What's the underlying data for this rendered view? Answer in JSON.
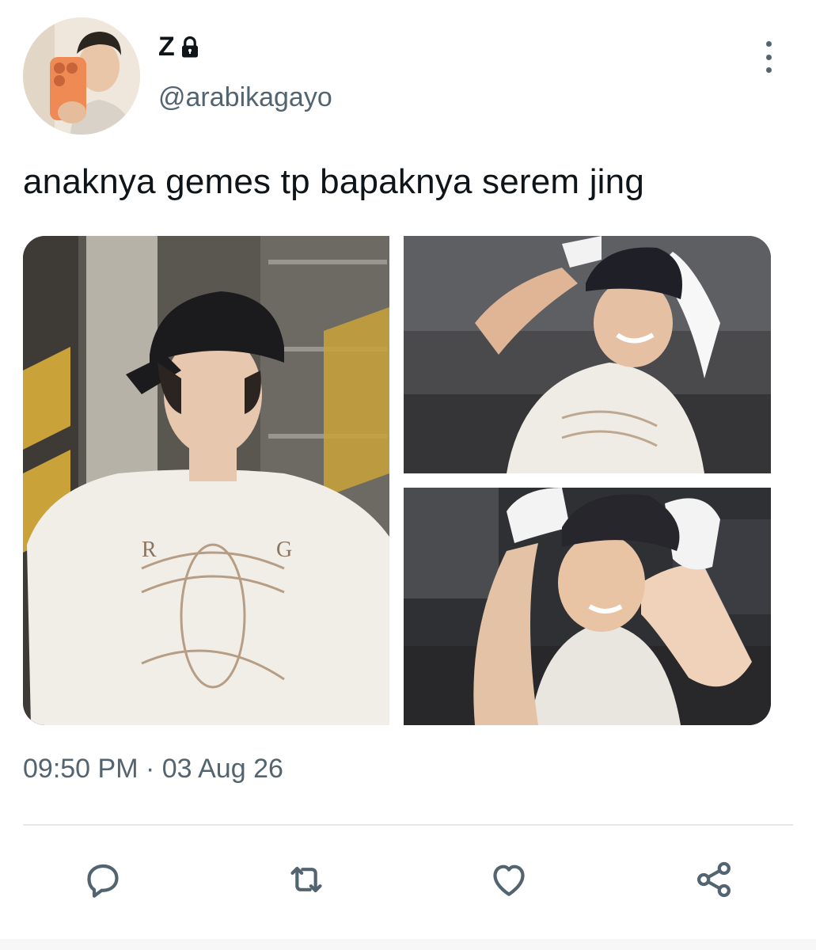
{
  "author": {
    "display_name": "Z",
    "handle": "@arabikagayo",
    "protected_icon": "lock-icon"
  },
  "tweet": {
    "text": "anaknya gemes tp bapaknya serem jing",
    "timestamp": "09:50 PM · 03 Aug 26"
  },
  "media": [
    {
      "name": "photo-1",
      "icon": "image"
    },
    {
      "name": "photo-2",
      "icon": "image"
    },
    {
      "name": "photo-3",
      "icon": "image"
    }
  ],
  "actions": [
    {
      "name": "reply",
      "icon": "reply-icon"
    },
    {
      "name": "retweet",
      "icon": "retweet-icon"
    },
    {
      "name": "like",
      "icon": "heart-icon"
    },
    {
      "name": "share",
      "icon": "share-icon"
    }
  ],
  "colors": {
    "text_primary": "#0f1419",
    "text_secondary": "#536471",
    "divider": "#e6e9ec",
    "icon": "#536471"
  }
}
